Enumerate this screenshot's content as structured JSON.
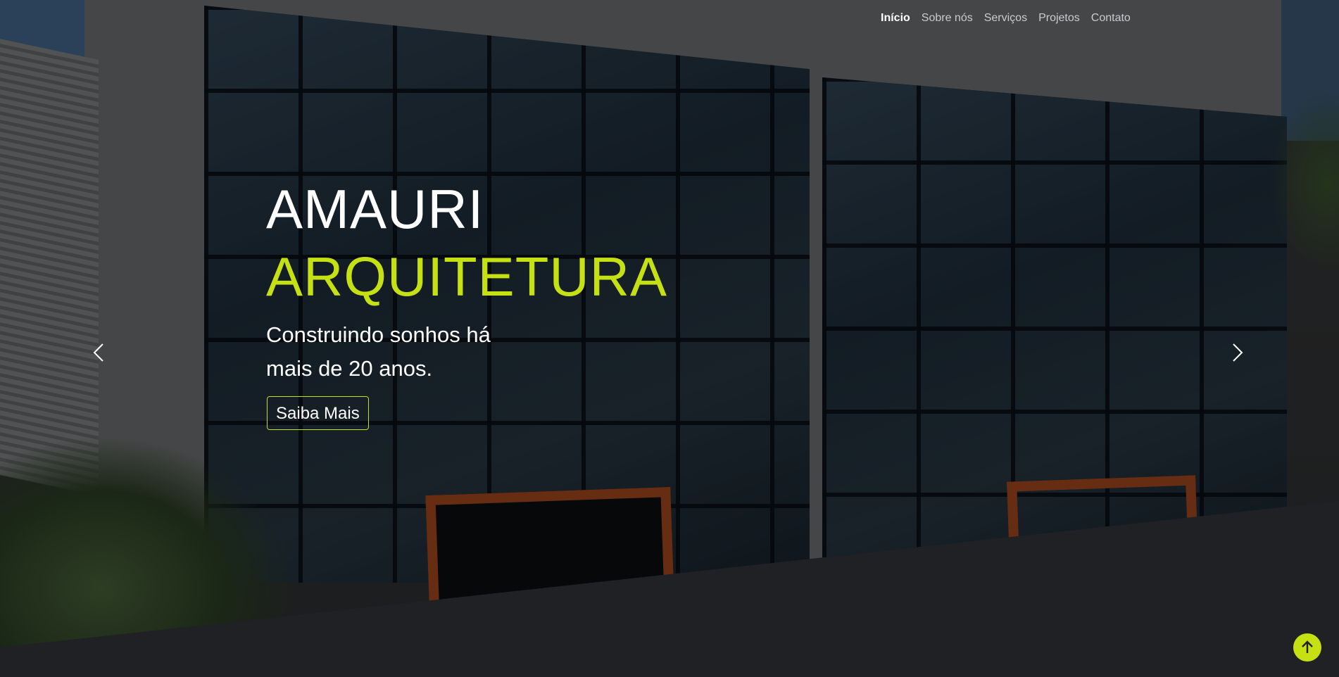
{
  "nav": {
    "items": [
      {
        "label": "Início",
        "active": true
      },
      {
        "label": "Sobre nós",
        "active": false
      },
      {
        "label": "Serviços",
        "active": false
      },
      {
        "label": "Projetos",
        "active": false
      },
      {
        "label": "Contato",
        "active": false
      }
    ]
  },
  "hero": {
    "title_line1": "AMAURI",
    "title_line2": "ARQUITETURA",
    "subtitle": "Construindo sonhos há mais de 20 anos.",
    "cta_label": "Saiba Mais"
  },
  "carousel": {
    "prev_icon": "chevron-left-icon",
    "next_icon": "chevron-right-icon"
  },
  "back_to_top": {
    "icon": "arrow-up-icon"
  },
  "colors": {
    "accent": "#c5e013",
    "background": "#1f2125",
    "text": "#ffffff",
    "nav_text": "#c9cbce"
  }
}
